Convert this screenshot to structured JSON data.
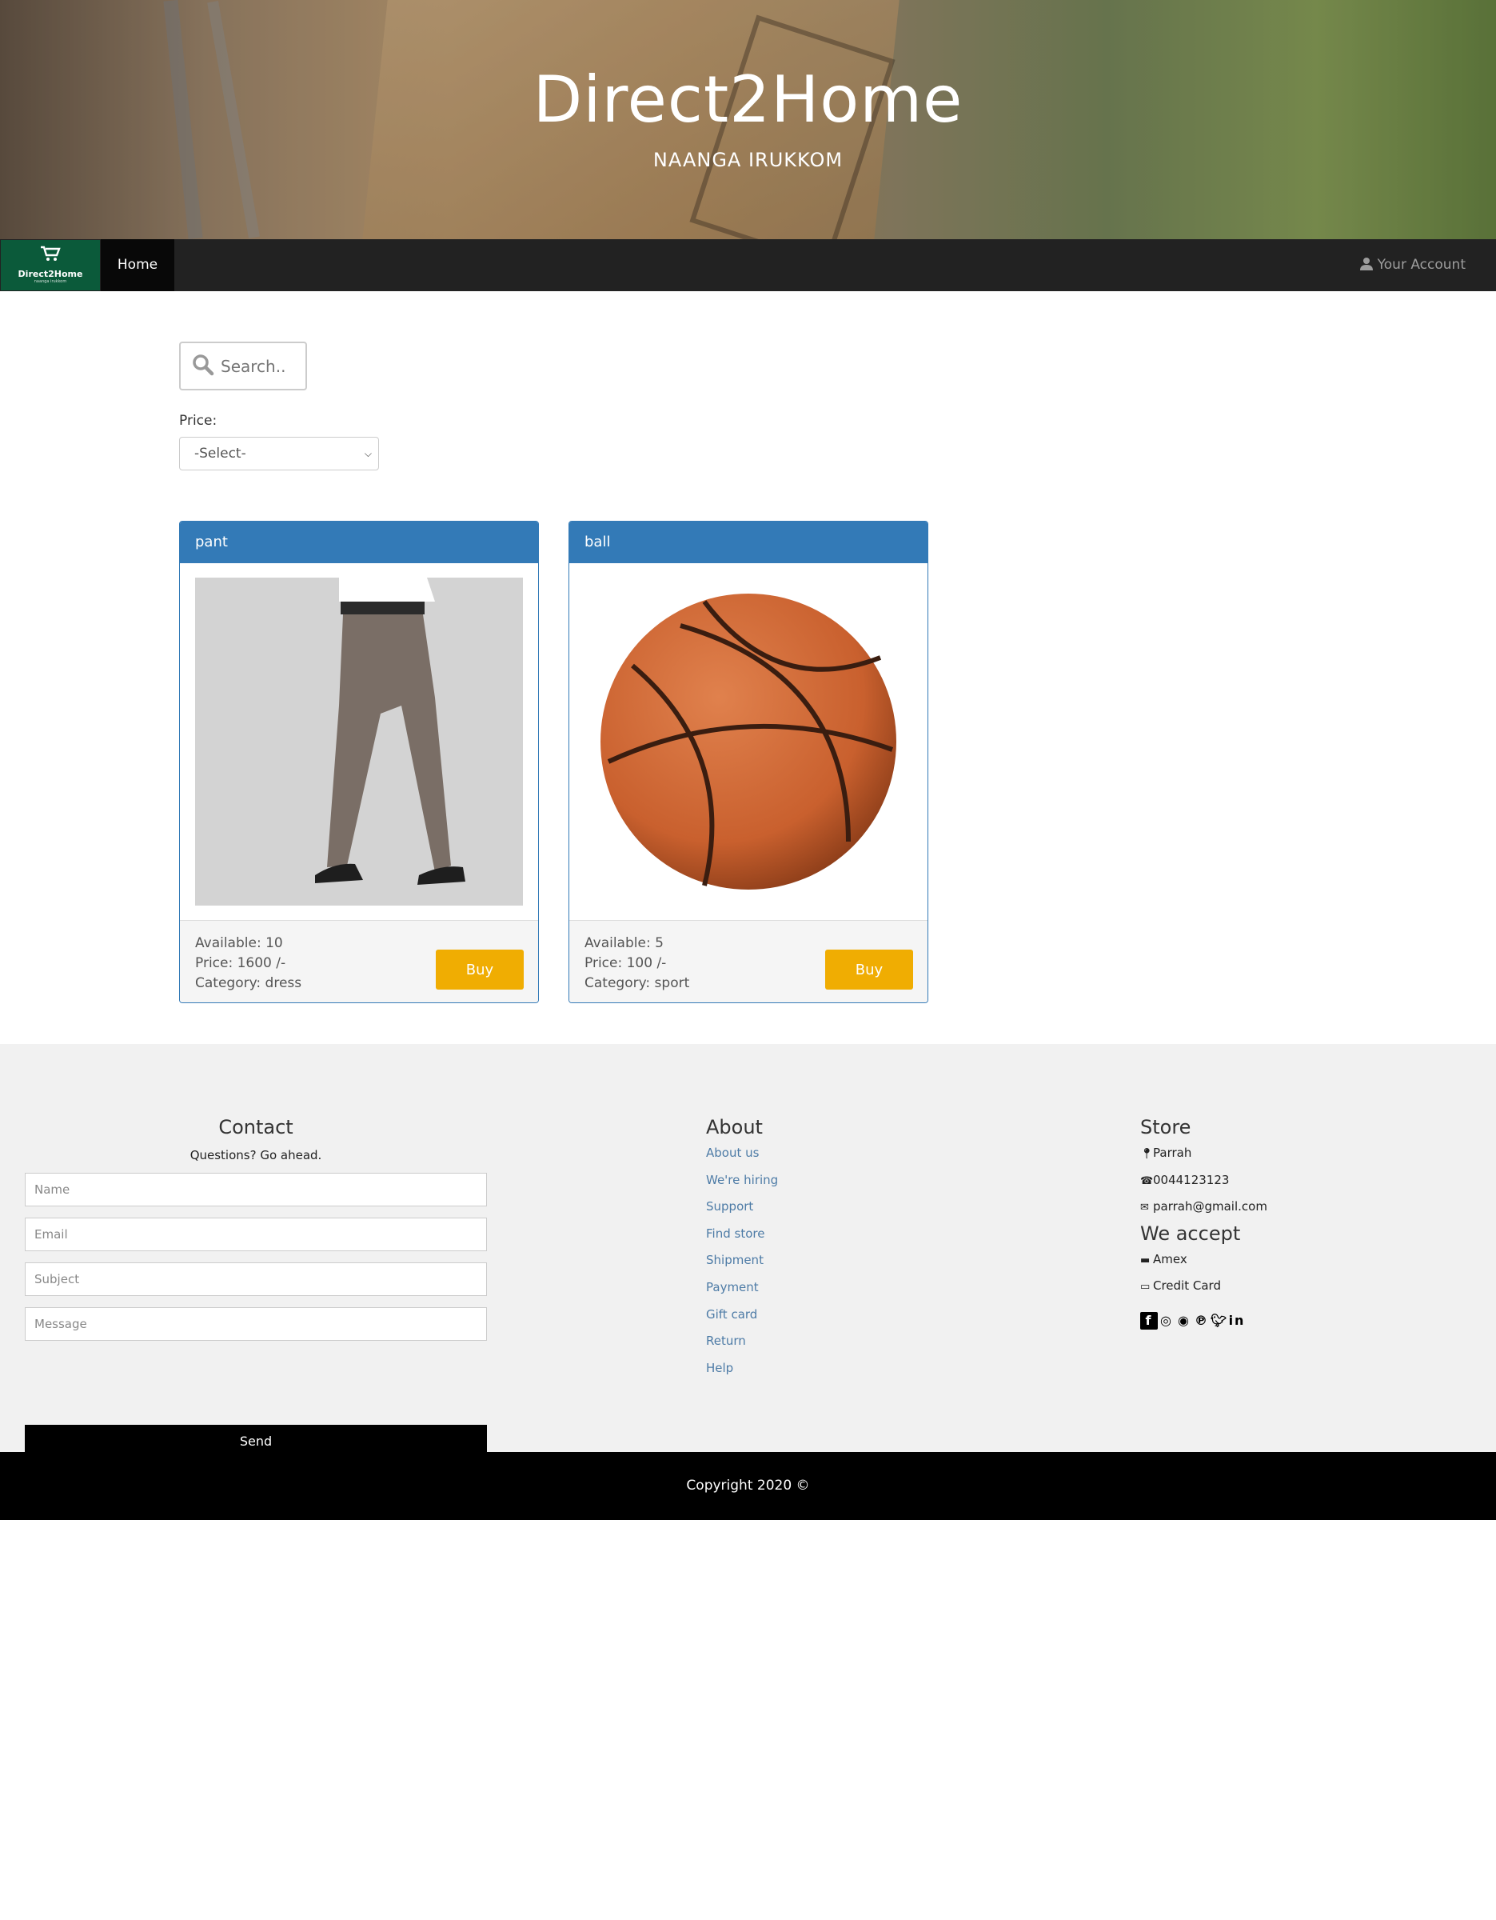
{
  "hero": {
    "title": "Direct2Home",
    "subtitle": "NAANGA IRUKKOM"
  },
  "nav": {
    "logo_text": "Direct2Home",
    "logo_tagline": "naanga irukkom",
    "home_label": "Home",
    "account_label": "Your Account"
  },
  "search": {
    "placeholder": "Search.."
  },
  "filter": {
    "label": "Price:",
    "selected": "-Select-"
  },
  "products": [
    {
      "name": "pant",
      "available": "Available: 10",
      "price": "Price: 1600 /-",
      "category": "Category: dress",
      "buy_label": "Buy"
    },
    {
      "name": "ball",
      "available": "Available: 5",
      "price": "Price: 100 /-",
      "category": "Category: sport",
      "buy_label": "Buy"
    }
  ],
  "footer": {
    "contact": {
      "title": "Contact",
      "subtitle": "Questions? Go ahead.",
      "name_placeholder": "Name",
      "email_placeholder": "Email",
      "subject_placeholder": "Subject",
      "message_placeholder": "Message",
      "send_label": "Send"
    },
    "about": {
      "title": "About",
      "links": [
        "About us",
        "We're hiring",
        "Support",
        "Find store",
        "Shipment",
        "Payment",
        "Gift card",
        "Return",
        "Help"
      ]
    },
    "store": {
      "title": "Store",
      "location": "Parrah",
      "phone": "0044123123",
      "email": "parrah@gmail.com",
      "accept_title": "We accept",
      "payments": [
        "Amex",
        "Credit Card"
      ],
      "social_icons": [
        "facebook-icon",
        "instagram-icon",
        "snapchat-icon",
        "pinterest-icon",
        "twitter-icon",
        "linkedin-icon"
      ]
    }
  },
  "copyright": "Copyright 2020 ©",
  "colors": {
    "primary": "#337ab7",
    "buy": "#f0ad02",
    "navbar": "#222222",
    "logo_bg": "#0b5a3a"
  }
}
